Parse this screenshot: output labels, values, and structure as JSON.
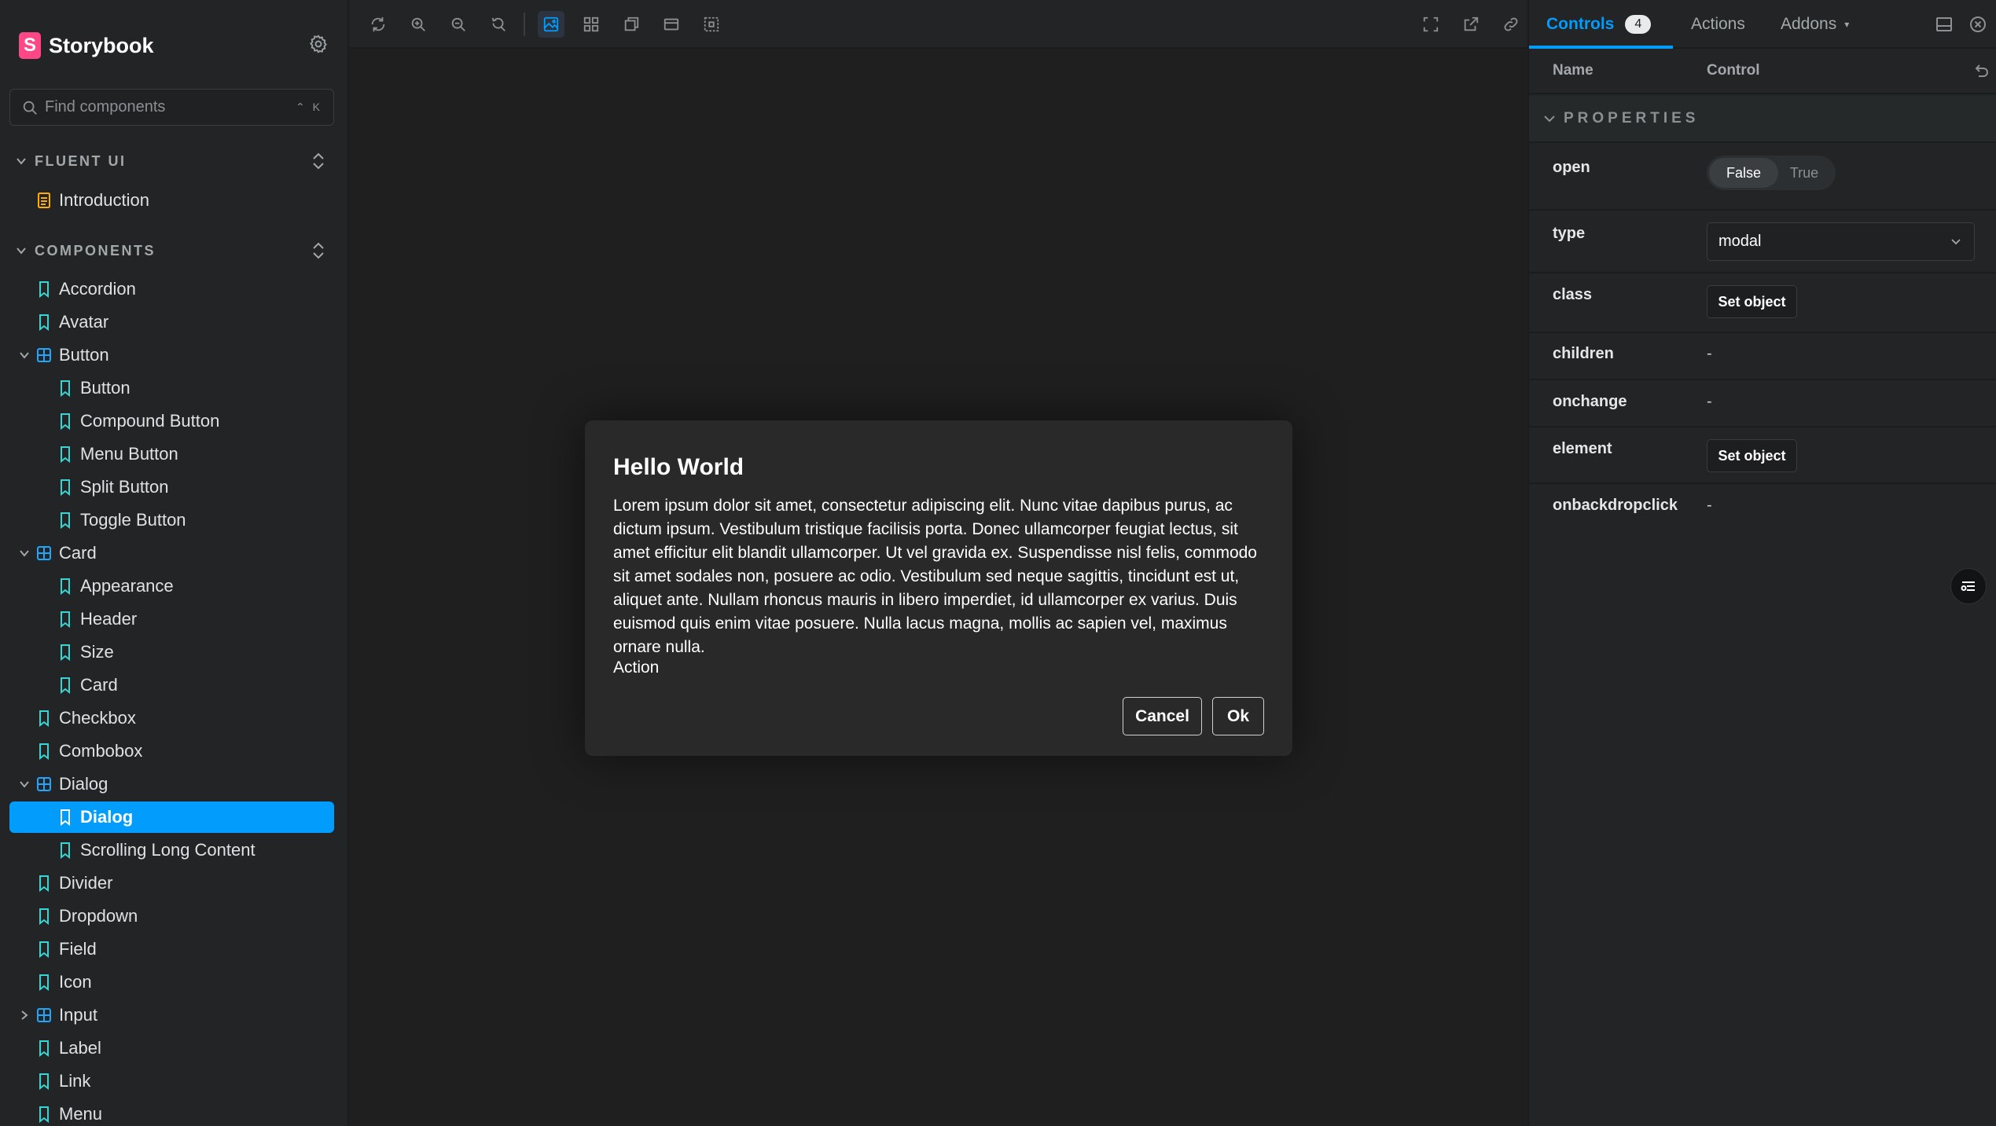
{
  "app": {
    "brand": "Storybook"
  },
  "search": {
    "placeholder": "Find components",
    "shortcut": "⌃ K"
  },
  "sidebar": {
    "sections": [
      {
        "label": "FLUENT UI"
      },
      {
        "label": "COMPONENTS"
      }
    ],
    "items": [
      {
        "label": "Introduction"
      },
      {
        "label": "Accordion"
      },
      {
        "label": "Avatar"
      },
      {
        "label": "Button"
      },
      {
        "label": "Button"
      },
      {
        "label": "Compound Button"
      },
      {
        "label": "Menu Button"
      },
      {
        "label": "Split Button"
      },
      {
        "label": "Toggle Button"
      },
      {
        "label": "Card"
      },
      {
        "label": "Appearance"
      },
      {
        "label": "Header"
      },
      {
        "label": "Size"
      },
      {
        "label": "Card"
      },
      {
        "label": "Checkbox"
      },
      {
        "label": "Combobox"
      },
      {
        "label": "Dialog"
      },
      {
        "label": "Dialog"
      },
      {
        "label": "Scrolling Long Content"
      },
      {
        "label": "Divider"
      },
      {
        "label": "Dropdown"
      },
      {
        "label": "Field"
      },
      {
        "label": "Icon"
      },
      {
        "label": "Input"
      },
      {
        "label": "Label"
      },
      {
        "label": "Link"
      },
      {
        "label": "Menu"
      }
    ]
  },
  "toolbar": {
    "icons": [
      "reload-icon",
      "zoom-in-icon",
      "zoom-out-icon",
      "reset-zoom-icon",
      "background-icon",
      "grid-icon",
      "outline-icon",
      "viewport-icon",
      "measure-icon",
      "fullscreen-icon",
      "open-new-tab-icon",
      "copy-link-icon"
    ]
  },
  "dialog": {
    "title": "Hello World",
    "body": "Lorem ipsum dolor sit amet, consectetur adipiscing elit. Nunc vitae dapibus purus, ac dictum ipsum. Vestibulum tristique facilisis porta. Donec ullamcorper feugiat lectus, sit amet efficitur elit blandit ullamcorper. Ut vel gravida ex. Suspendisse nisl felis, commodo sit amet sodales non, posuere ac odio. Vestibulum sed neque sagittis, tincidunt est ut, aliquet ante. Nullam rhoncus mauris in libero imperdiet, id ullamcorper ex varius. Duis euismod quis enim vitae posuere. Nulla lacus magna, mollis ac sapien vel, maximus ornare nulla.",
    "action": "Action",
    "cancel_label": "Cancel",
    "ok_label": "Ok"
  },
  "panel": {
    "tabs": {
      "controls": "Controls",
      "controls_count": "4",
      "actions": "Actions",
      "addons": "Addons"
    },
    "columns": {
      "name": "Name",
      "control": "Control"
    },
    "group_label": "PROPERTIES",
    "props": {
      "open": {
        "name": "open",
        "false_label": "False",
        "true_label": "True",
        "value": false
      },
      "type": {
        "name": "type",
        "value": "modal"
      },
      "class": {
        "name": "class",
        "button": "Set object"
      },
      "children": {
        "name": "children",
        "value": "-"
      },
      "onchange": {
        "name": "onchange",
        "value": "-"
      },
      "element": {
        "name": "element",
        "button": "Set object"
      },
      "onbackdropclick": {
        "name": "onbackdropclick",
        "value": "-"
      }
    }
  },
  "colors": {
    "accent": "#029cfd",
    "brand": "#ff4785",
    "component_icon": "#1ea7fd",
    "story_icon": "#37d5d3",
    "doc_icon": "#ffae00"
  }
}
